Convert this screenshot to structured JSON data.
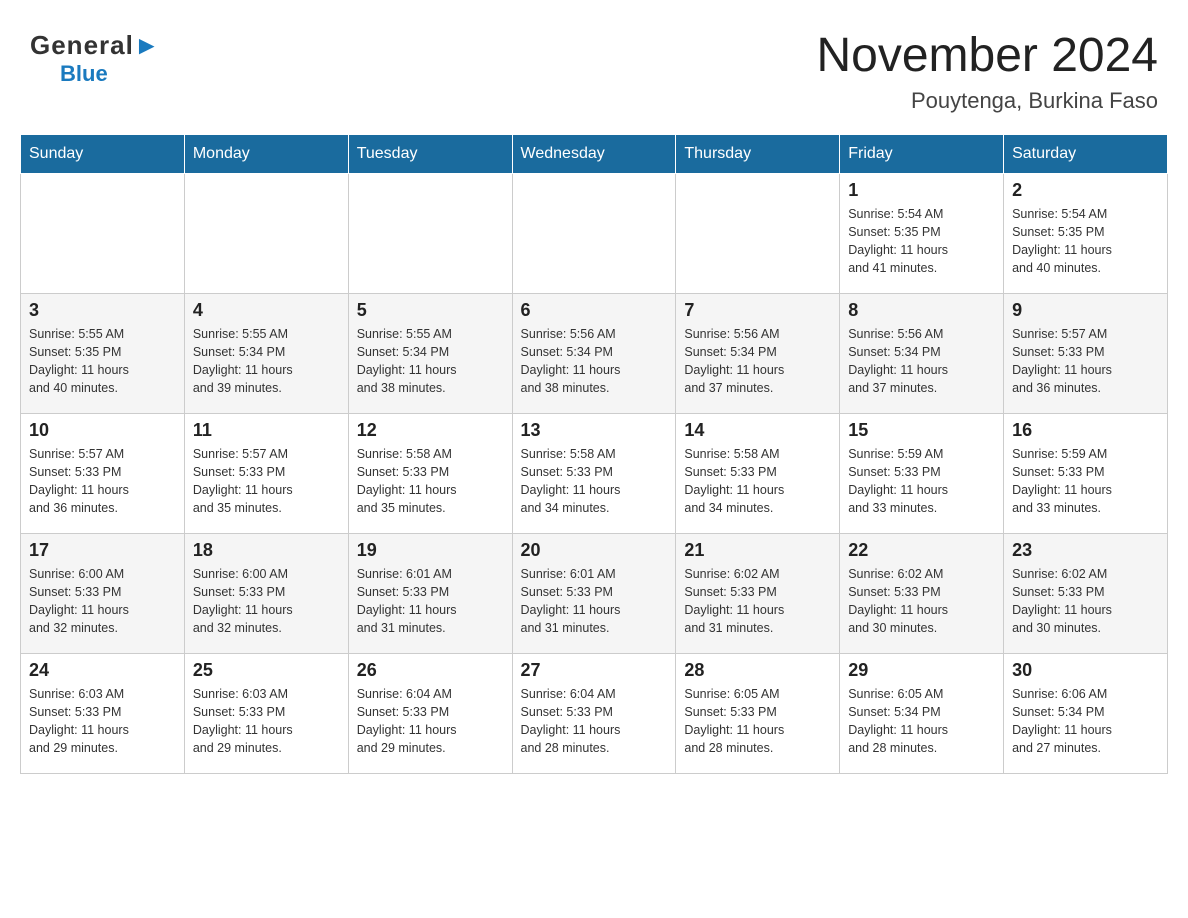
{
  "header": {
    "logo_general": "General",
    "logo_blue": "Blue",
    "month_year": "November 2024",
    "location": "Pouytenga, Burkina Faso"
  },
  "days_of_week": [
    "Sunday",
    "Monday",
    "Tuesday",
    "Wednesday",
    "Thursday",
    "Friday",
    "Saturday"
  ],
  "weeks": [
    [
      {
        "day": "",
        "info": ""
      },
      {
        "day": "",
        "info": ""
      },
      {
        "day": "",
        "info": ""
      },
      {
        "day": "",
        "info": ""
      },
      {
        "day": "",
        "info": ""
      },
      {
        "day": "1",
        "info": "Sunrise: 5:54 AM\nSunset: 5:35 PM\nDaylight: 11 hours\nand 41 minutes."
      },
      {
        "day": "2",
        "info": "Sunrise: 5:54 AM\nSunset: 5:35 PM\nDaylight: 11 hours\nand 40 minutes."
      }
    ],
    [
      {
        "day": "3",
        "info": "Sunrise: 5:55 AM\nSunset: 5:35 PM\nDaylight: 11 hours\nand 40 minutes."
      },
      {
        "day": "4",
        "info": "Sunrise: 5:55 AM\nSunset: 5:34 PM\nDaylight: 11 hours\nand 39 minutes."
      },
      {
        "day": "5",
        "info": "Sunrise: 5:55 AM\nSunset: 5:34 PM\nDaylight: 11 hours\nand 38 minutes."
      },
      {
        "day": "6",
        "info": "Sunrise: 5:56 AM\nSunset: 5:34 PM\nDaylight: 11 hours\nand 38 minutes."
      },
      {
        "day": "7",
        "info": "Sunrise: 5:56 AM\nSunset: 5:34 PM\nDaylight: 11 hours\nand 37 minutes."
      },
      {
        "day": "8",
        "info": "Sunrise: 5:56 AM\nSunset: 5:34 PM\nDaylight: 11 hours\nand 37 minutes."
      },
      {
        "day": "9",
        "info": "Sunrise: 5:57 AM\nSunset: 5:33 PM\nDaylight: 11 hours\nand 36 minutes."
      }
    ],
    [
      {
        "day": "10",
        "info": "Sunrise: 5:57 AM\nSunset: 5:33 PM\nDaylight: 11 hours\nand 36 minutes."
      },
      {
        "day": "11",
        "info": "Sunrise: 5:57 AM\nSunset: 5:33 PM\nDaylight: 11 hours\nand 35 minutes."
      },
      {
        "day": "12",
        "info": "Sunrise: 5:58 AM\nSunset: 5:33 PM\nDaylight: 11 hours\nand 35 minutes."
      },
      {
        "day": "13",
        "info": "Sunrise: 5:58 AM\nSunset: 5:33 PM\nDaylight: 11 hours\nand 34 minutes."
      },
      {
        "day": "14",
        "info": "Sunrise: 5:58 AM\nSunset: 5:33 PM\nDaylight: 11 hours\nand 34 minutes."
      },
      {
        "day": "15",
        "info": "Sunrise: 5:59 AM\nSunset: 5:33 PM\nDaylight: 11 hours\nand 33 minutes."
      },
      {
        "day": "16",
        "info": "Sunrise: 5:59 AM\nSunset: 5:33 PM\nDaylight: 11 hours\nand 33 minutes."
      }
    ],
    [
      {
        "day": "17",
        "info": "Sunrise: 6:00 AM\nSunset: 5:33 PM\nDaylight: 11 hours\nand 32 minutes."
      },
      {
        "day": "18",
        "info": "Sunrise: 6:00 AM\nSunset: 5:33 PM\nDaylight: 11 hours\nand 32 minutes."
      },
      {
        "day": "19",
        "info": "Sunrise: 6:01 AM\nSunset: 5:33 PM\nDaylight: 11 hours\nand 31 minutes."
      },
      {
        "day": "20",
        "info": "Sunrise: 6:01 AM\nSunset: 5:33 PM\nDaylight: 11 hours\nand 31 minutes."
      },
      {
        "day": "21",
        "info": "Sunrise: 6:02 AM\nSunset: 5:33 PM\nDaylight: 11 hours\nand 31 minutes."
      },
      {
        "day": "22",
        "info": "Sunrise: 6:02 AM\nSunset: 5:33 PM\nDaylight: 11 hours\nand 30 minutes."
      },
      {
        "day": "23",
        "info": "Sunrise: 6:02 AM\nSunset: 5:33 PM\nDaylight: 11 hours\nand 30 minutes."
      }
    ],
    [
      {
        "day": "24",
        "info": "Sunrise: 6:03 AM\nSunset: 5:33 PM\nDaylight: 11 hours\nand 29 minutes."
      },
      {
        "day": "25",
        "info": "Sunrise: 6:03 AM\nSunset: 5:33 PM\nDaylight: 11 hours\nand 29 minutes."
      },
      {
        "day": "26",
        "info": "Sunrise: 6:04 AM\nSunset: 5:33 PM\nDaylight: 11 hours\nand 29 minutes."
      },
      {
        "day": "27",
        "info": "Sunrise: 6:04 AM\nSunset: 5:33 PM\nDaylight: 11 hours\nand 28 minutes."
      },
      {
        "day": "28",
        "info": "Sunrise: 6:05 AM\nSunset: 5:33 PM\nDaylight: 11 hours\nand 28 minutes."
      },
      {
        "day": "29",
        "info": "Sunrise: 6:05 AM\nSunset: 5:34 PM\nDaylight: 11 hours\nand 28 minutes."
      },
      {
        "day": "30",
        "info": "Sunrise: 6:06 AM\nSunset: 5:34 PM\nDaylight: 11 hours\nand 27 minutes."
      }
    ]
  ]
}
